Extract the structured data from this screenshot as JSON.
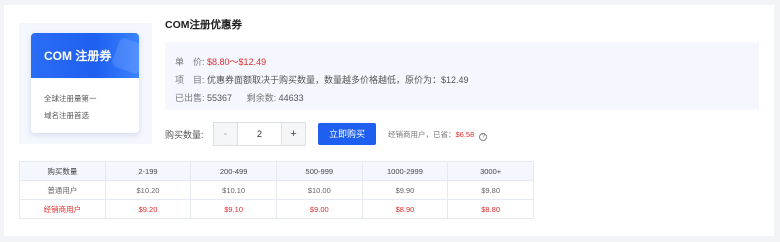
{
  "product": {
    "title": "COM注册优惠券",
    "voucher_title": "COM 注册券",
    "features": [
      "全球注册量第一",
      "域名注册首选"
    ]
  },
  "info": {
    "price_label": "单　价:",
    "price_value": "$8.80～$12.49",
    "item_label": "项　目:",
    "item_text": "优惠券面额取决于购买数量，数量越多价格越低，原价为：$12.49",
    "sold_label": "已出售:",
    "sold_value": "55367",
    "remain_label": "剩余数:",
    "remain_value": "44633"
  },
  "purchase": {
    "qty_label": "购买数量:",
    "minus": "-",
    "quantity": "2",
    "plus": "+",
    "buy_label": "立即购买",
    "note_text": "经销商用户，已省：",
    "note_saved": "$6.58",
    "help": "?"
  },
  "table": {
    "headers": [
      "购买数量",
      "2-199",
      "200-499",
      "500-999",
      "1000-2999",
      "3000+"
    ],
    "rows": [
      [
        "普通用户",
        "$10.20",
        "$10.10",
        "$10.00",
        "$9.90",
        "$9.80"
      ],
      [
        "经销商用户",
        "$9.20",
        "$9.10",
        "$9.00",
        "$8.90",
        "$8.80"
      ]
    ]
  },
  "colors": {
    "accent": "#1f5ff0",
    "price_red": "#e02d2d",
    "panel_bg": "#f4f7fd"
  }
}
